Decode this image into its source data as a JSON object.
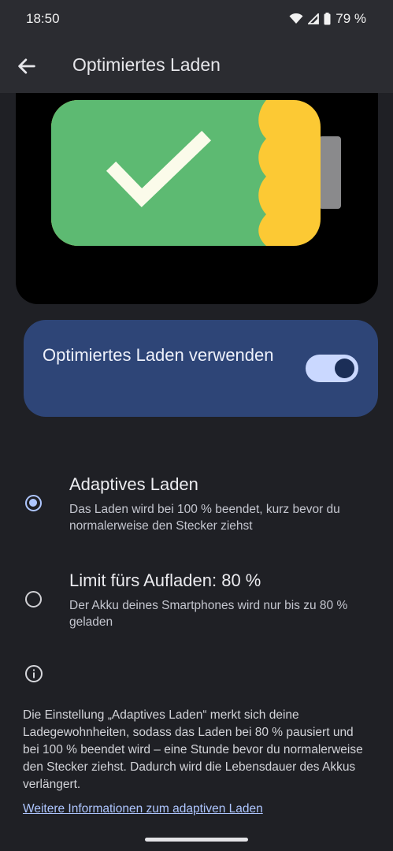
{
  "status": {
    "time": "18:50",
    "battery": "79 %",
    "icons": [
      "wifi-icon",
      "signal-icon",
      "battery-icon"
    ]
  },
  "appbar": {
    "back_icon": "back-arrow-icon",
    "title": "Optimiertes Laden"
  },
  "illustration": {
    "icon": "battery-charged-check-illustration",
    "colors": {
      "green": "#5dba72",
      "yellow": "#fcc934",
      "terminal": "#8a8a8c",
      "check": "#fbfbea"
    }
  },
  "toggle": {
    "label": "Optimiertes Laden verwenden",
    "state": "on"
  },
  "options": [
    {
      "title": "Adaptives Laden",
      "subtitle": "Das Laden wird bei 100 % beendet, kurz bevor du normalerweise den Stecker ziehst",
      "selected": true
    },
    {
      "title": "Limit fürs Aufladen: 80 %",
      "subtitle": "Der Akku deines Smartphones wird nur bis zu 80 % geladen",
      "selected": false
    }
  ],
  "info": {
    "icon": "info-icon",
    "text": "Die Einstellung „Adaptives Laden“ merkt sich deine Ladegewohnheiten, sodass das Laden bei 80 % pausiert und bei 100 % beendet wird – eine Stunde bevor du normalerweise den Stecker ziehst. Dadurch wird die Lebensdauer des Akkus verlängert.",
    "link": "Weitere Informationen zum adaptiven Laden"
  },
  "colors": {
    "background": "#1f2025",
    "card": "#2e4577",
    "accent": "#aec6ff"
  }
}
